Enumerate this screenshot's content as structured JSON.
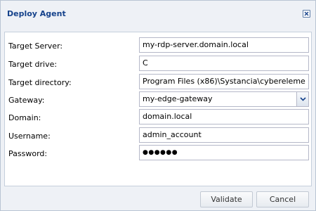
{
  "dialog": {
    "title": "Deploy Agent"
  },
  "form": {
    "target_server": {
      "label": "Target Server:",
      "value": "my-rdp-server.domain.local"
    },
    "target_drive": {
      "label": "Target drive:",
      "value": "C"
    },
    "target_directory": {
      "label": "Target directory:",
      "value": "Program Files (x86)\\Systancia\\cybereleme"
    },
    "gateway": {
      "label": "Gateway:",
      "value": "my-edge-gateway"
    },
    "domain": {
      "label": "Domain:",
      "value": "domain.local"
    },
    "username": {
      "label": "Username:",
      "value": "admin_account"
    },
    "password": {
      "label": "Password:",
      "value": "●●●●●●"
    }
  },
  "buttons": {
    "validate": "Validate",
    "cancel": "Cancel"
  },
  "icons": {
    "close": "close-icon",
    "dropdown": "chevron-down-icon"
  },
  "colors": {
    "title": "#15428b",
    "background": "#eef1f6",
    "panel": "#ffffff",
    "border": "#b5b8c8"
  }
}
